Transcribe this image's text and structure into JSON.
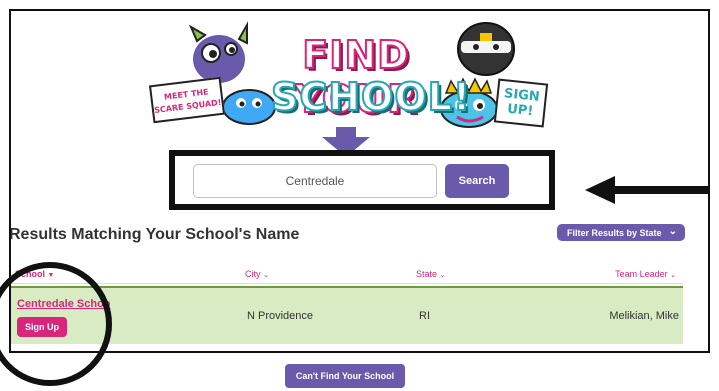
{
  "banner": {
    "line1": "FIND YOUR",
    "line2": "SCHOOL!",
    "left_badge": [
      "MEET THE",
      "SCARE SQUAD!"
    ],
    "right_badge": [
      "SIGN",
      "UP!"
    ]
  },
  "search": {
    "value": "Centredale",
    "button": "Search"
  },
  "results": {
    "title": "Results Matching Your School's Name",
    "filter_label": "Filter Results by State"
  },
  "table": {
    "headers": {
      "school": "School",
      "city": "City",
      "state": "State",
      "leader": "Team Leader"
    },
    "rows": [
      {
        "school": "Centredale Schoo",
        "action": "Sign Up",
        "city": "N Providence",
        "state": "RI",
        "leader": "Melikian, Mike"
      }
    ]
  },
  "footer": {
    "cant_find": "Can't Find Your School"
  },
  "colors": {
    "purple": "#6a5aac",
    "magenta": "#d7267b",
    "teal": "#27a9b5",
    "row_green": "#d8ebc3"
  }
}
